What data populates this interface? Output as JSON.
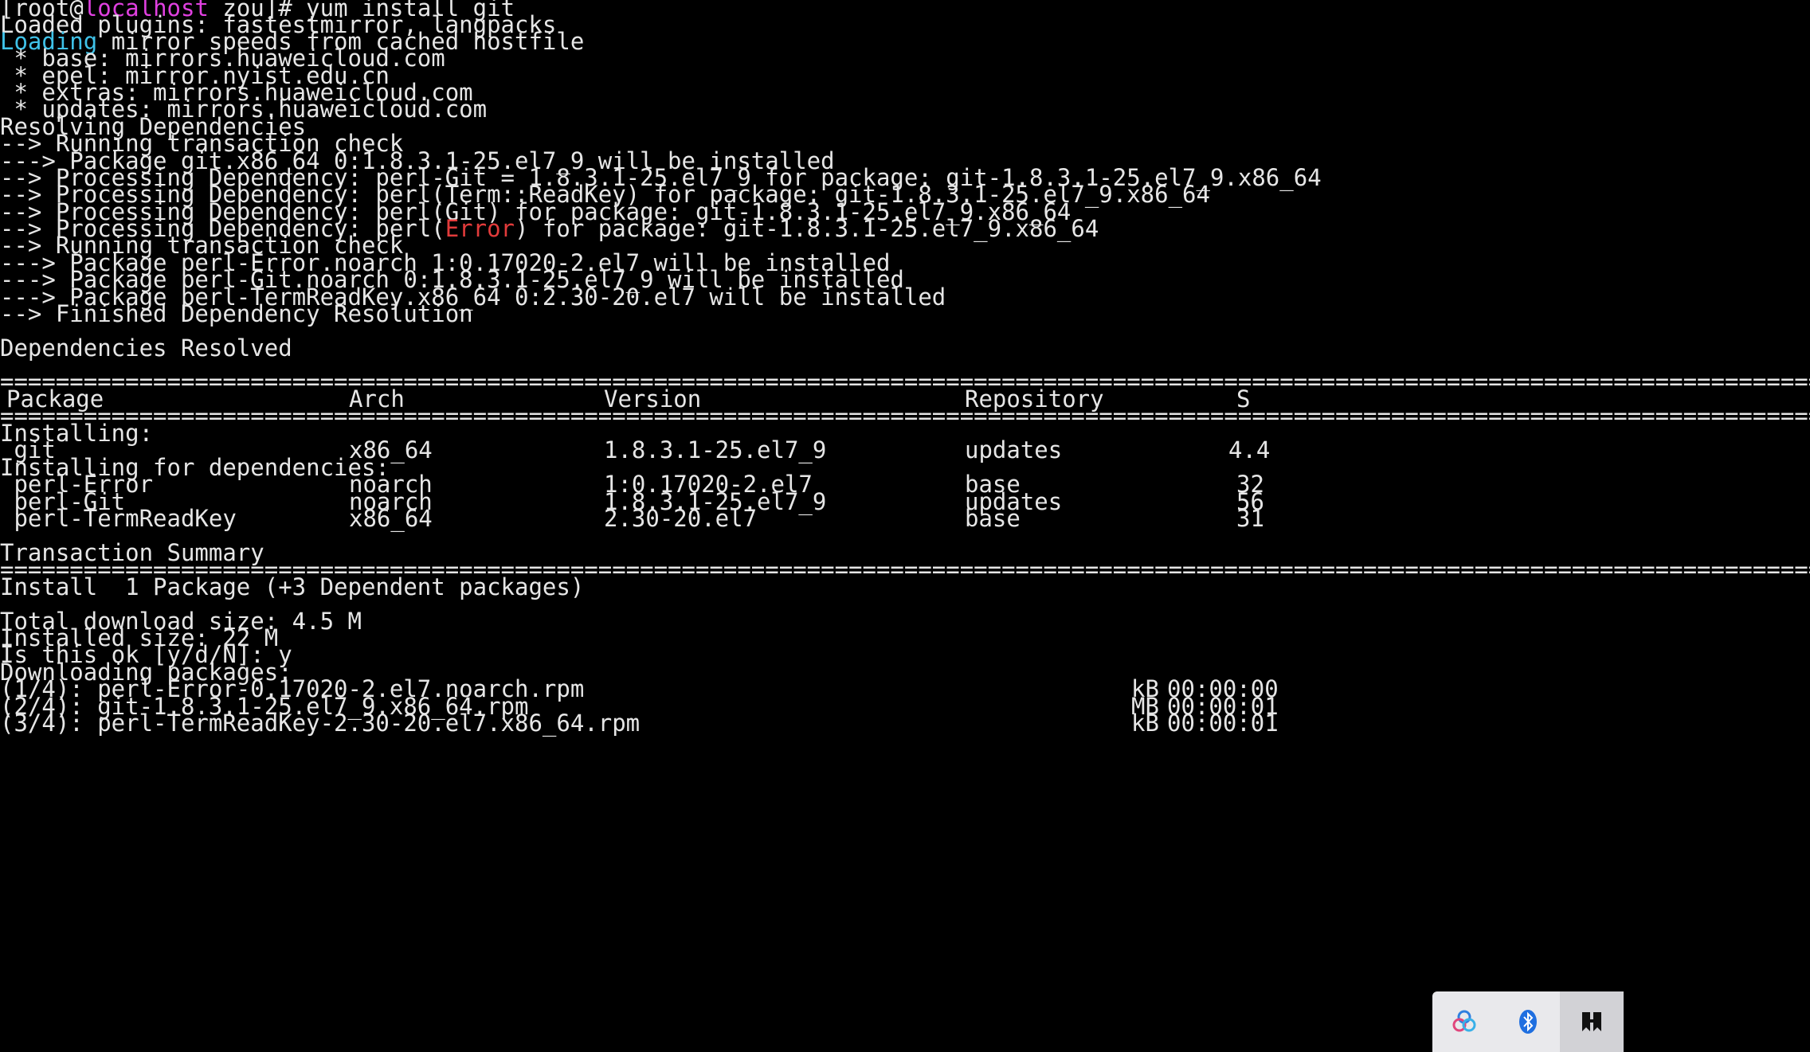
{
  "terminal": {
    "prompt_user": "root",
    "prompt_host": "localhost",
    "prompt_dir": "zou",
    "command": "yum install git",
    "lines": [
      "Loaded plugins: fastestmirror, langpacks",
      "mirror speeds from cached hostfile",
      " * base: mirrors.huaweicloud.com",
      " * epel: mirror.nyist.edu.cn",
      " * extras: mirrors.huaweicloud.com",
      " * updates: mirrors.huaweicloud.com",
      "Resolving Dependencies",
      "--> Running transaction check",
      "---> Package git.x86_64 0:1.8.3.1-25.el7_9 will be installed",
      "--> Processing Dependency: perl-Git = 1.8.3.1-25.el7_9 for package: git-1.8.3.1-25.el7_9.x86_64",
      "--> Processing Dependency: perl(Term::ReadKey) for package: git-1.8.3.1-25.el7_9.x86_64",
      "--> Processing Dependency: perl(Git) for package: git-1.8.3.1-25.el7_9.x86_64",
      "--> Processing Dependency: perl(",
      ") for package: git-1.8.3.1-25.el7_9.x86_64",
      "--> Running transaction check",
      "---> Package perl-Error.noarch 1:0.17020-2.el7 will be installed",
      "---> Package perl-Git.noarch 0:1.8.3.1-25.el7_9 will be installed",
      "---> Package perl-TermReadKey.x86_64 0:2.30-20.el7 will be installed",
      "--> Finished Dependency Resolution",
      "Dependencies Resolved",
      "Installing:",
      "Installing for dependencies:",
      "Transaction Summary",
      "Install  1 Package (+3 Dependent packages)",
      "Total download size: 4.5 M",
      "Installed size: 22 M",
      "Is this ok [y/d/N]: y",
      "Downloading packages:",
      "(1/4): perl-Error-0.17020-2.el7.noarch.rpm",
      "(2/4): git-1.8.3.1-25.el7_9.x86_64.rpm",
      "(3/4): perl-TermReadKey-2.30-20.el7.x86_64.rpm"
    ],
    "loading_word": "Loading",
    "error_word": "Error",
    "separator": "==============================================================================================================================================================================================================================",
    "table": {
      "headers": [
        "Package",
        "Arch",
        "Version",
        "Repository",
        "S"
      ],
      "installing": [
        {
          "name": " git",
          "arch": "x86_64",
          "version": "1.8.3.1-25.el7_9",
          "repo": "updates",
          "size": "4.4"
        }
      ],
      "dependencies": [
        {
          "name": " perl-Error",
          "arch": "noarch",
          "version": "1:0.17020-2.el7",
          "repo": "base",
          "size": "32"
        },
        {
          "name": " perl-Git",
          "arch": "noarch",
          "version": "1.8.3.1-25.el7_9",
          "repo": "updates",
          "size": "56"
        },
        {
          "name": " perl-TermReadKey",
          "arch": "x86_64",
          "version": "2.30-20.el7",
          "repo": "base",
          "size": "31"
        }
      ]
    },
    "downloads": [
      {
        "size": "kB",
        "time": "00:00:00"
      },
      {
        "size": "MB",
        "time": "00:00:01"
      },
      {
        "size": "kB",
        "time": "00:00:01"
      }
    ]
  },
  "tray": {
    "icons": [
      "photos-icon",
      "bluetooth-icon",
      "app-icon"
    ]
  }
}
